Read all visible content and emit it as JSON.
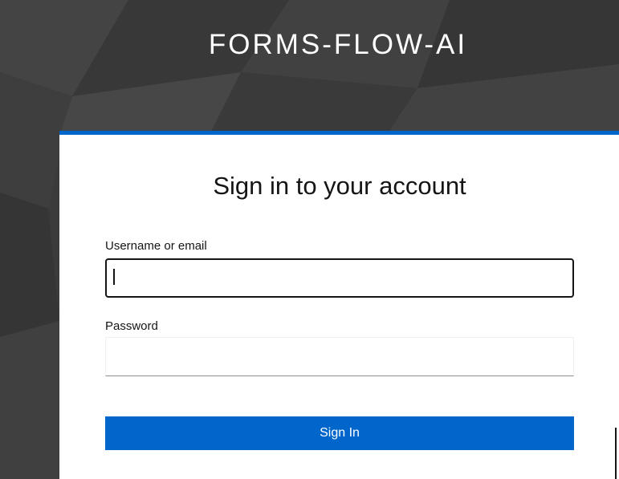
{
  "app": {
    "brand": "FORMS-FLOW-AI"
  },
  "login": {
    "title": "Sign in to your account",
    "username_label": "Username or email",
    "username_value": "",
    "password_label": "Password",
    "password_value": "",
    "submit_label": "Sign In"
  },
  "colors": {
    "accent": "#0066cc",
    "background": "#3a3a3a",
    "card": "#ffffff"
  }
}
